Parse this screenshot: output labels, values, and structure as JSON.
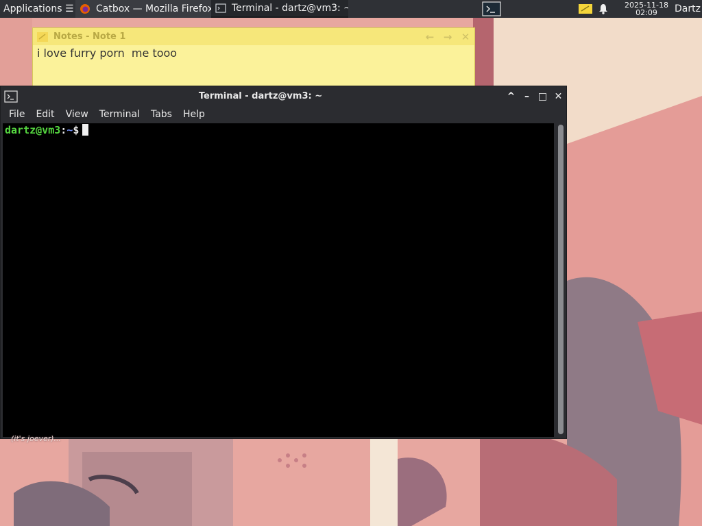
{
  "panel": {
    "applications_label": "Applications ☰",
    "tasks": [
      {
        "label": "Catbox — Mozilla Firefox",
        "icon": "firefox-icon"
      },
      {
        "label": "Terminal - dartz@vm3: ~",
        "icon": "terminal-icon"
      }
    ],
    "clock_date": "2025-11-18",
    "clock_time": "02:09",
    "user_label": "Dartz"
  },
  "notes_window": {
    "title": "Notes - Note 1",
    "content": "i love furry porn  me tooo",
    "controls": {
      "prev": "←",
      "next": "→",
      "close": "✕"
    }
  },
  "terminal_window": {
    "title": "Terminal - dartz@vm3: ~",
    "controls": {
      "shade": "^",
      "minimize": "–",
      "maximize": "□",
      "close": "✕"
    },
    "menu": [
      "File",
      "Edit",
      "View",
      "Terminal",
      "Tabs",
      "Help"
    ],
    "prompt": {
      "user_host": "dartz@vm3",
      "separator": ":",
      "path": "~",
      "symbol": "$"
    }
  },
  "wallpaper_caption": "(it's joever)...",
  "colors": {
    "panel_bg": "#2f3136",
    "notes_bg": "#fbf29a",
    "terminal_bg": "#000000",
    "prompt_user": "#55d640",
    "prompt_path": "#6f8cf0"
  }
}
